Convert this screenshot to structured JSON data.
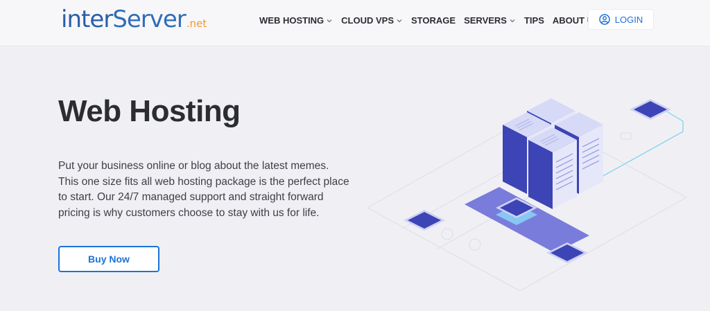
{
  "logo": {
    "part1": "inter",
    "part2": "Server",
    "part3": ".net"
  },
  "nav": {
    "items": [
      {
        "label": "WEB HOSTING",
        "has_dropdown": true
      },
      {
        "label": "CLOUD VPS",
        "has_dropdown": true
      },
      {
        "label": "STORAGE",
        "has_dropdown": false
      },
      {
        "label": "SERVERS",
        "has_dropdown": true
      },
      {
        "label": "TIPS",
        "has_dropdown": false
      },
      {
        "label": "ABOUT US",
        "has_dropdown": true
      }
    ],
    "login_label": "LOGIN",
    "login_icon": "user-circle-icon"
  },
  "hero": {
    "title": "Web Hosting",
    "description": "Put your business online or blog about the latest memes. This one size fits all web hosting package is the perfect place to start. Our 24/7 managed support and straight forward pricing is why customers choose to stay with us for life.",
    "cta_label": "Buy Now"
  },
  "colors": {
    "accent": "#1a73d9",
    "logo_blue": "#2f6db7",
    "logo_orange": "#f39a23",
    "server_dark": "#3e45b8",
    "server_light": "#d9dcf5",
    "background": "#f0f0f4"
  }
}
